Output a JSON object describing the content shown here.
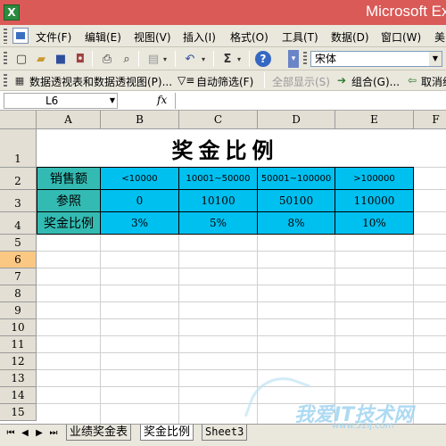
{
  "window": {
    "title": "Microsoft Ex",
    "app_icon": "X"
  },
  "menubar": {
    "items": [
      "文件(F)",
      "编辑(E)",
      "视图(V)",
      "插入(I)",
      "格式(O)",
      "工具(T)",
      "数据(D)",
      "窗口(W)",
      "美"
    ]
  },
  "toolbar": {
    "font_name": "宋体",
    "sum_symbol": "Σ",
    "help_symbol": "?"
  },
  "pivot_toolbar": {
    "pivot_label": "数据透视表和数据透视图(P)...",
    "autofilter_label": "自动筛选(F)",
    "show_all_label": "全部显示(S)",
    "group_label": "组合(G)...",
    "ungroup_label": "取消组"
  },
  "formula_bar": {
    "name_box": "L6",
    "fx": "fx",
    "formula": ""
  },
  "columns": [
    "A",
    "B",
    "C",
    "D",
    "E",
    "F"
  ],
  "rows": [
    "1",
    "2",
    "3",
    "4",
    "5",
    "6",
    "7",
    "8",
    "9",
    "10",
    "11",
    "12",
    "13",
    "14",
    "15"
  ],
  "selected_cell": "L6",
  "table": {
    "title": "奖金比例",
    "row_labels": [
      "销售额",
      "参照",
      "奖金比例"
    ],
    "sales_ranges": [
      "<10000",
      "10001~50000",
      "50001~100000",
      ">100000"
    ],
    "reference": [
      "0",
      "10100",
      "50100",
      "110000"
    ],
    "bonus_rates": [
      "3%",
      "5%",
      "8%",
      "10%"
    ]
  },
  "sheet_tabs": {
    "tabs": [
      "业绩奖金表",
      "奖金比例",
      "Sheet3"
    ],
    "active": "奖金比例"
  },
  "watermark": {
    "text": "我爱IT技术网",
    "url": "www.52ij.com"
  },
  "colors": {
    "header_cyan": "#00c0f0",
    "label_teal": "#33bbb3",
    "title_bar": "#d95a57",
    "selected_row_header": "#fbc884"
  }
}
